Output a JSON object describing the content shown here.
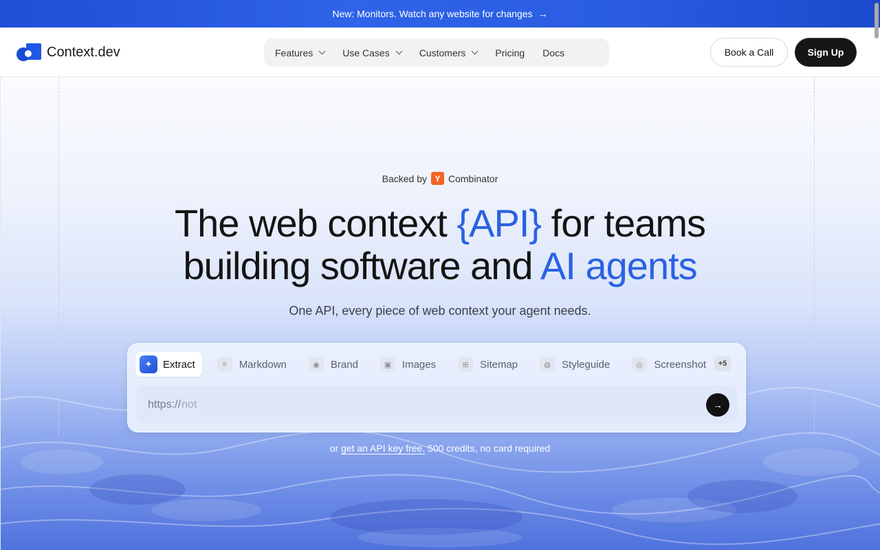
{
  "announcement": {
    "text": "New: Monitors. Watch any website for changes",
    "arrow": "→"
  },
  "brand": {
    "name": "Context.dev",
    "accent": "#1f57e6"
  },
  "nav": {
    "items": [
      {
        "label": "Features",
        "dropdown": true
      },
      {
        "label": "Use Cases",
        "dropdown": true
      },
      {
        "label": "Customers",
        "dropdown": true
      },
      {
        "label": "Pricing",
        "dropdown": false
      },
      {
        "label": "Docs",
        "dropdown": false
      }
    ]
  },
  "header": {
    "book_call": "Book a Call",
    "sign_up": "Sign Up"
  },
  "hero": {
    "backed_prefix": "Backed by",
    "yc_letter": "Y",
    "backed_suffix": "Combinator",
    "headline_1": "The web context ",
    "headline_accent_1": "{API}",
    "headline_2": " for teams",
    "headline_3": "building software and ",
    "headline_accent_2": "AI agents",
    "subtitle": "One API, every piece of web context your agent needs."
  },
  "tool": {
    "tabs": [
      {
        "label": "Extract",
        "icon": "sparkle-icon",
        "glyph": "✦",
        "active": true
      },
      {
        "label": "Markdown",
        "icon": "text-lines-icon",
        "glyph": "≡",
        "active": false
      },
      {
        "label": "Brand",
        "icon": "brand-icon",
        "glyph": "◉",
        "active": false
      },
      {
        "label": "Images",
        "icon": "image-icon",
        "glyph": "▣",
        "active": false
      },
      {
        "label": "Sitemap",
        "icon": "map-icon",
        "glyph": "⊞",
        "active": false
      },
      {
        "label": "Styleguide",
        "icon": "palette-icon",
        "glyph": "◍",
        "active": false
      },
      {
        "label": "Screenshot",
        "icon": "camera-icon",
        "glyph": "◎",
        "active": false
      }
    ],
    "more_label": "+5",
    "url_prefix": "https://",
    "url_placeholder": "not",
    "submit_arrow": "→"
  },
  "cta": {
    "prefix": "or ",
    "link": "get an API key free.",
    "suffix": " 500 credits, no card required"
  },
  "colors": {
    "accent": "#2b62e3",
    "dark_button": "#161616",
    "yc_orange": "#f26522"
  }
}
